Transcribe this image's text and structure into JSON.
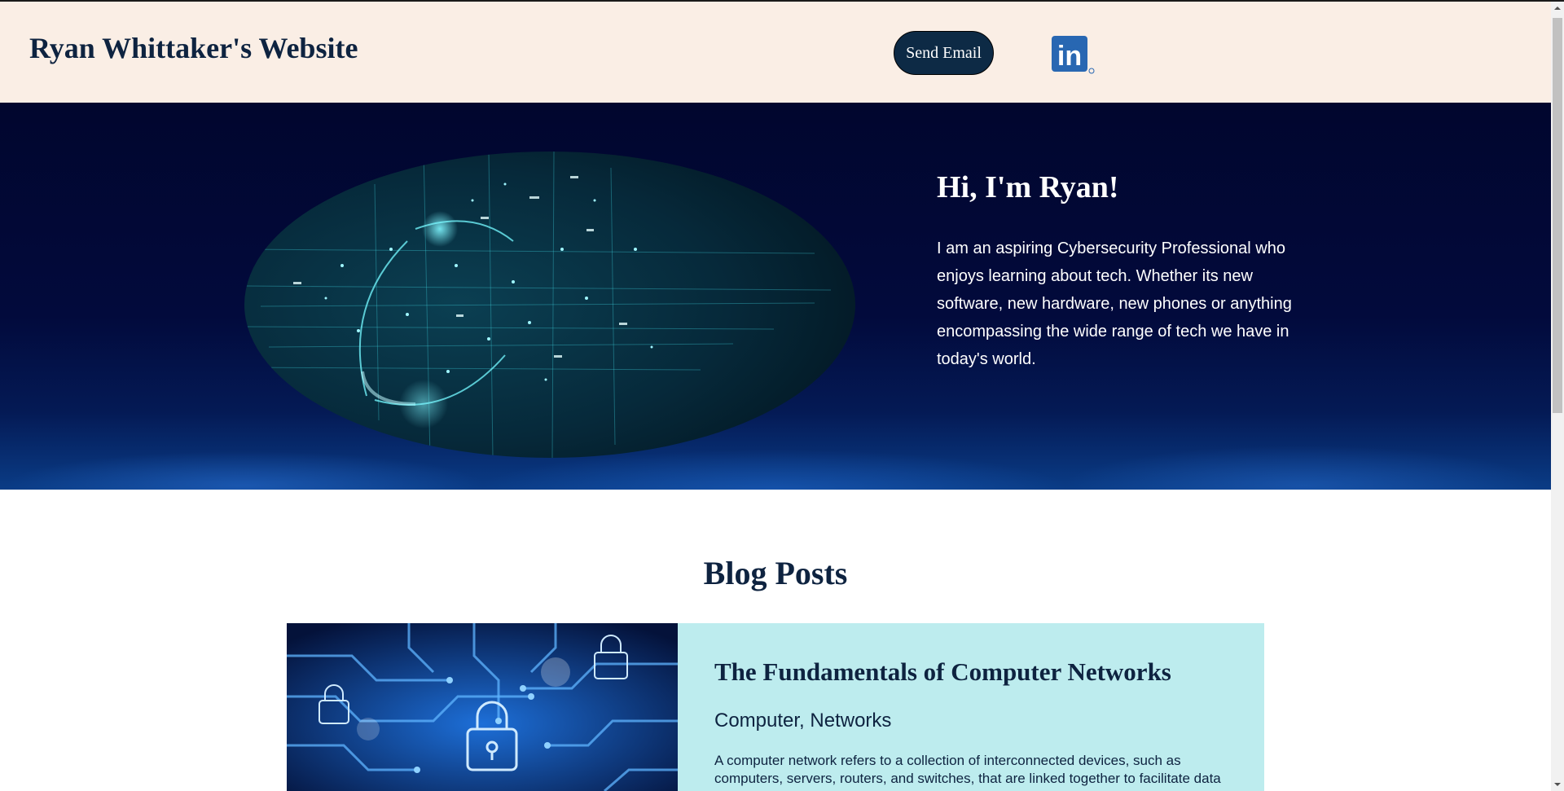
{
  "header": {
    "site_title": "Ryan Whittaker's Website",
    "email_button": "Send Email",
    "linkedin_icon": "linkedin-icon",
    "linkedin_text": "in"
  },
  "hero": {
    "heading": "Hi, I'm Ryan!",
    "text": "I am an aspiring Cybersecurity Professional who enjoys learning about tech. Whether its new software, new hardware, new phones or anything encompassing the wide range of tech we have in today's world."
  },
  "blog": {
    "title": "Blog Posts",
    "posts": [
      {
        "title": "The Fundamentals of Computer Networks",
        "tags": "Computer, Networks",
        "excerpt": "A computer network refers to a collection of interconnected devices, such as computers, servers, routers, and switches, that are linked together to facilitate data"
      }
    ]
  },
  "colors": {
    "header_bg": "#faeee5",
    "navy": "#0e2340",
    "card_bg": "#bdecee",
    "button_bg": "#0d2a45",
    "linkedin_blue": "#2867b2"
  }
}
